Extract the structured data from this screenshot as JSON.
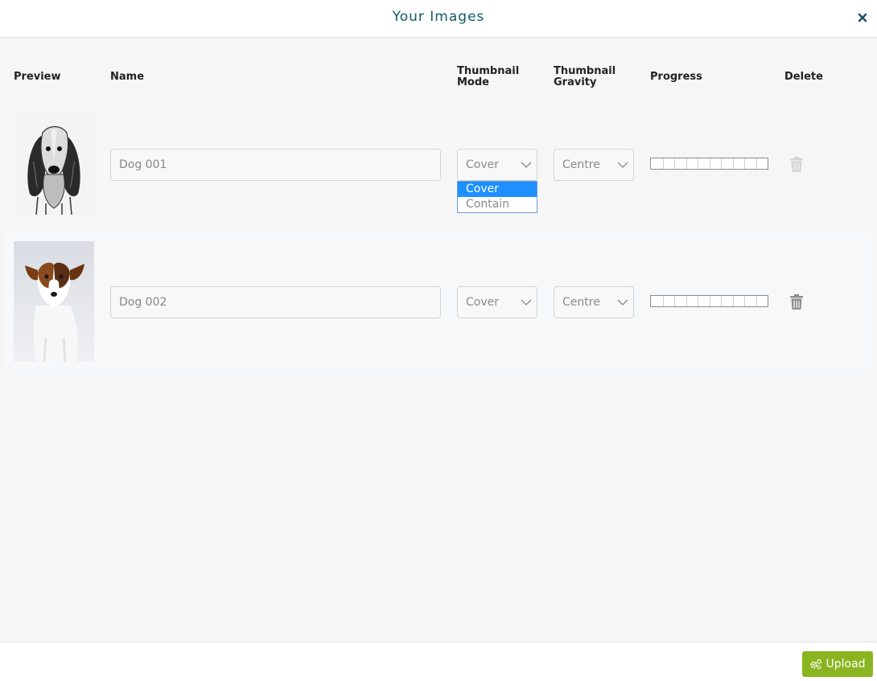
{
  "header": {
    "title": "Your Images"
  },
  "columns": {
    "preview": "Preview",
    "name": "Name",
    "thumbnail_mode_line1": "Thumbnail",
    "thumbnail_mode_line2": "Mode",
    "thumbnail_gravity_line1": "Thumbnail",
    "thumbnail_gravity_line2": "Gravity",
    "progress": "Progress",
    "delete": "Delete"
  },
  "rows": [
    {
      "name": "Dog 001",
      "mode": "Cover",
      "gravity": "Centre",
      "progress": 0,
      "preview": "sketch-dog-image"
    },
    {
      "name": "Dog 002",
      "mode": "Cover",
      "gravity": "Centre",
      "progress": 0,
      "preview": "photo-dog-image"
    }
  ],
  "mode_dropdown": {
    "options": [
      "Cover",
      "Contain"
    ],
    "selected": "Cover"
  },
  "footer": {
    "upload_label": "Upload"
  },
  "icons": {
    "close": "close-icon",
    "chevron": "chevron-down-icon",
    "trash": "trash-icon",
    "upload": "cogs-icon"
  },
  "colors": {
    "title": "#0f5a66",
    "accent_green": "#8ab520",
    "dropdown_selected": "#1e90ff"
  }
}
